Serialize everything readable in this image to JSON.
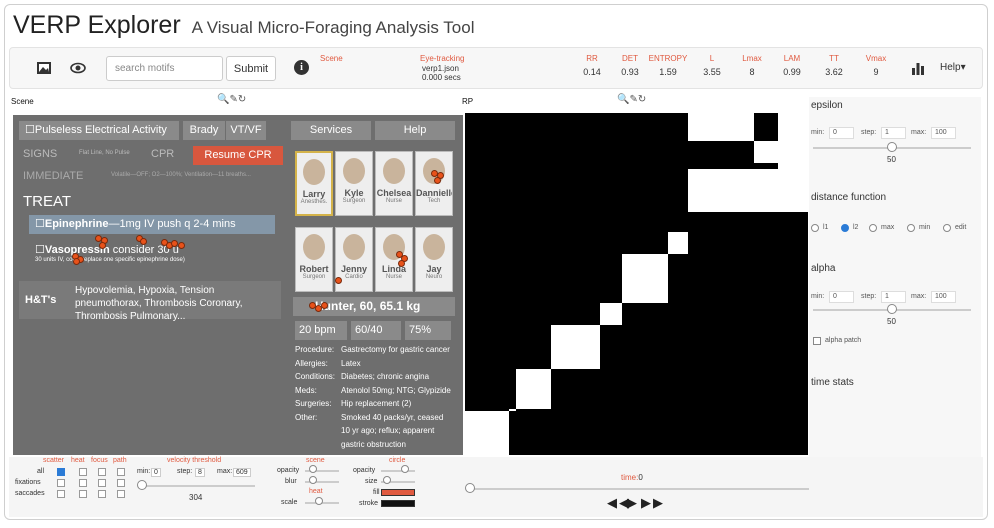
{
  "app": {
    "title": "VERP Explorer",
    "subtitle": "A Visual Micro-Foraging Analysis Tool"
  },
  "toolbar": {
    "search_placeholder": "search motifs",
    "submit_label": "Submit",
    "scene_label": "Scene",
    "eyetracking_label": "Eye-tracking",
    "eyetracking_file": "verp1.json",
    "eyetracking_time": "0.000 secs",
    "metrics": [
      {
        "key": "RR",
        "value": "0.14"
      },
      {
        "key": "DET",
        "value": "0.93"
      },
      {
        "key": "ENTROPY",
        "value": "1.59"
      },
      {
        "key": "L",
        "value": "3.55"
      },
      {
        "key": "Lmax",
        "value": "8"
      },
      {
        "key": "LAM",
        "value": "0.99"
      },
      {
        "key": "TT",
        "value": "3.62"
      },
      {
        "key": "Vmax",
        "value": "9"
      }
    ],
    "help_label": "Help▾"
  },
  "scene_panel": {
    "label": "Scene",
    "header": "Pulseless Electrical Activity",
    "brady": "Brady",
    "vtvf": "VT/VF",
    "services": "Services",
    "help": "Help",
    "signs": "SIGNS",
    "signs_detail": "Flat Line, No Pulse",
    "cpr": "CPR",
    "resume_cpr": "Resume CPR",
    "immediate": "IMMEDIATE",
    "immediate_detail": "Volatile—OFF; O2—100%; Ventilation—11 breaths...",
    "treat": "TREAT",
    "epi": "Epinephrine",
    "epi_detail": "—1mg IV push q 2-4 mins",
    "vaso": "Vasopressin",
    "vaso_detail": "consider 30 u",
    "vaso_note": "30 units IV, could replace one specific epinephrine dose)",
    "ht": "H&T's",
    "ht_detail": "Hypovolemia, Hypoxia, Tension pneumothorax, Thrombosis Coronary, Thrombosis Pulmonary...",
    "people": [
      {
        "name": "Larry",
        "role": "Anesthes."
      },
      {
        "name": "Kyle",
        "role": "Surgeon"
      },
      {
        "name": "Chelsea",
        "role": "Nurse"
      },
      {
        "name": "Dannielle",
        "role": "Tech"
      },
      {
        "name": "Robert",
        "role": "Surgeon"
      },
      {
        "name": "Jenny",
        "role": "Cardio"
      },
      {
        "name": "Linda",
        "role": "Nurse"
      },
      {
        "name": "Jay",
        "role": "Neuro"
      }
    ],
    "patient": "Hunter, 60, 65.1 kg",
    "vitals": [
      "20 bpm",
      "60/40",
      "75%"
    ],
    "details": [
      {
        "k": "Procedure:",
        "v": "Gastrectomy for gastric cancer"
      },
      {
        "k": "Allergies:",
        "v": "Latex"
      },
      {
        "k": "Conditions:",
        "v": "Diabetes; chronic angina"
      },
      {
        "k": "Meds:",
        "v": "Atenolol 50mg; NTG; Glypizide"
      },
      {
        "k": "Surgeries:",
        "v": "Hip replacement (2)"
      },
      {
        "k": "Other:",
        "v": "Smoked 40 packs/yr, ceased"
      },
      {
        "k": "",
        "v": "10 yr ago; reflux; apparent"
      },
      {
        "k": "",
        "v": "gastric obstruction"
      }
    ]
  },
  "rp_panel": {
    "label": "RP"
  },
  "right_panel": {
    "epsilon": {
      "label": "epsilon",
      "min_label": "min:",
      "min": "0",
      "step_label": "step:",
      "step": "1",
      "max_label": "max:",
      "max": "100",
      "value": "50"
    },
    "distance": {
      "label": "distance function",
      "options": [
        "l1",
        "l2",
        "max",
        "min",
        "edit"
      ],
      "selected": "l2"
    },
    "alpha": {
      "label": "alpha",
      "min_label": "min:",
      "min": "0",
      "step_label": "step:",
      "step": "1",
      "max_label": "max:",
      "max": "100",
      "value": "50",
      "patch_label": "alpha patch"
    },
    "time_stats": "time stats"
  },
  "bottom": {
    "cols": [
      "scatter",
      "heat",
      "focus",
      "path"
    ],
    "rows": [
      "all",
      "fixations",
      "saccades"
    ],
    "velocity": "velocity threshold",
    "vmin_label": "min:",
    "vmin": "0",
    "vstep_label": "step:",
    "vstep": "8",
    "vmax_label": "max:",
    "vmax": "609",
    "vvalue": "304",
    "scene_label": "scene",
    "opacity": "opacity",
    "blur": "blur",
    "heat_label": "heat",
    "scale": "scale",
    "circle_label": "circle",
    "size": "size",
    "fill": "fill",
    "stroke": "stroke",
    "time_label": "time:",
    "time_value": "0"
  },
  "colors": {
    "accent": "#e05a40",
    "blue": "#2b7bd6",
    "dot": "#e8521a"
  }
}
